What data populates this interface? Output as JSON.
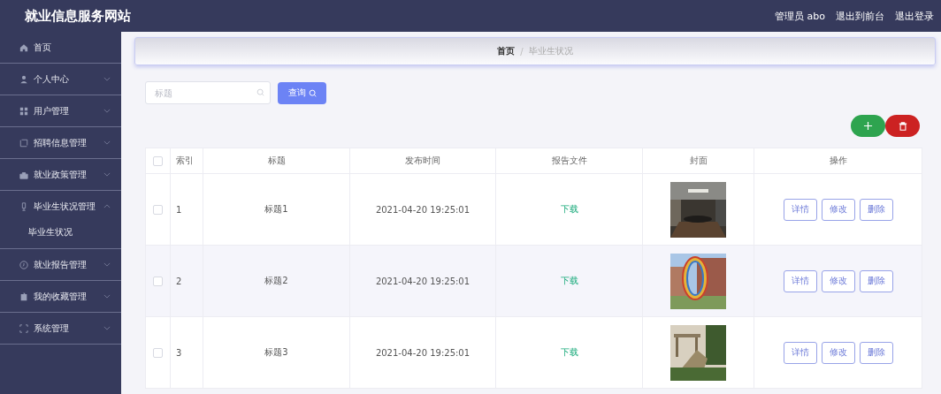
{
  "header": {
    "site_title": "就业信息服务网站",
    "user": "管理员 abo",
    "links": [
      "退出到前台",
      "退出登录"
    ]
  },
  "sidebar": {
    "items": [
      {
        "label": "首页"
      },
      {
        "label": "个人中心",
        "expanded": false
      },
      {
        "label": "用户管理",
        "expanded": false
      },
      {
        "label": "招聘信息管理",
        "expanded": false
      },
      {
        "label": "就业政策管理",
        "expanded": false
      },
      {
        "label": "毕业生状况管理",
        "expanded": true,
        "children": [
          {
            "label": "毕业生状况"
          }
        ]
      },
      {
        "label": "就业报告管理",
        "expanded": false
      },
      {
        "label": "我的收藏管理",
        "expanded": false
      },
      {
        "label": "系统管理",
        "expanded": false
      }
    ]
  },
  "breadcrumb": {
    "items": [
      "首页",
      "毕业生状况"
    ],
    "separator": "/"
  },
  "search": {
    "placeholder": "标题",
    "button": "查询"
  },
  "table": {
    "select_all": false,
    "columns": [
      "索引",
      "标题",
      "发布时间",
      "报告文件",
      "封面",
      "操作"
    ],
    "rows": [
      {
        "checked": false,
        "index": "1",
        "title": "标题1",
        "time": "2021-04-20 19:25:01",
        "file": "下载",
        "actions": [
          "详情",
          "修改",
          "删除"
        ]
      },
      {
        "checked": false,
        "index": "2",
        "title": "标题2",
        "time": "2021-04-20 19:25:01",
        "file": "下载",
        "actions": [
          "详情",
          "修改",
          "删除"
        ]
      },
      {
        "checked": false,
        "index": "3",
        "title": "标题3",
        "time": "2021-04-20 19:25:01",
        "file": "下载",
        "actions": [
          "详情",
          "修改",
          "删除"
        ]
      }
    ]
  }
}
